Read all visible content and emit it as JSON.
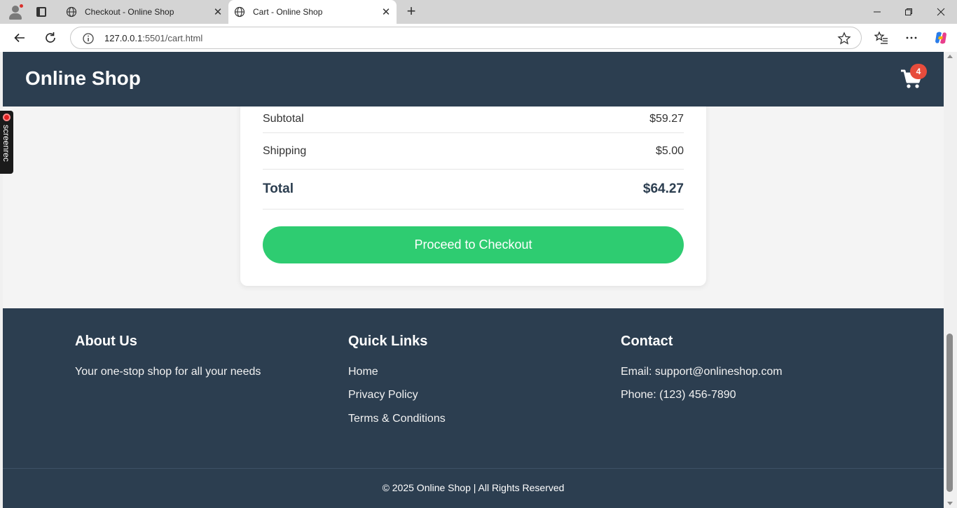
{
  "browser": {
    "tabs": [
      {
        "title": "Checkout - Online Shop",
        "active": false
      },
      {
        "title": "Cart - Online Shop",
        "active": true
      }
    ],
    "url_host": "127.0.0.1",
    "url_path": ":5501/cart.html"
  },
  "site": {
    "brand": "Online Shop",
    "cart_count": "4"
  },
  "summary": {
    "subtotal_label": "Subtotal",
    "subtotal_value": "$59.27",
    "shipping_label": "Shipping",
    "shipping_value": "$5.00",
    "total_label": "Total",
    "total_value": "$64.27",
    "checkout_label": "Proceed to Checkout"
  },
  "footer": {
    "about": {
      "heading": "About Us",
      "text": "Your one-stop shop for all your needs"
    },
    "links": {
      "heading": "Quick Links",
      "items": [
        "Home",
        "Privacy Policy",
        "Terms & Conditions"
      ]
    },
    "contact": {
      "heading": "Contact",
      "email": "Email: support@onlineshop.com",
      "phone": "Phone: (123) 456-7890"
    },
    "copyright": "© 2025 Online Shop | All Rights Reserved"
  },
  "overlay": {
    "recorder_label": "screenrec"
  },
  "colors": {
    "header_bg": "#2c3e50",
    "accent_green": "#2ecc71",
    "badge_red": "#e74c3c"
  }
}
